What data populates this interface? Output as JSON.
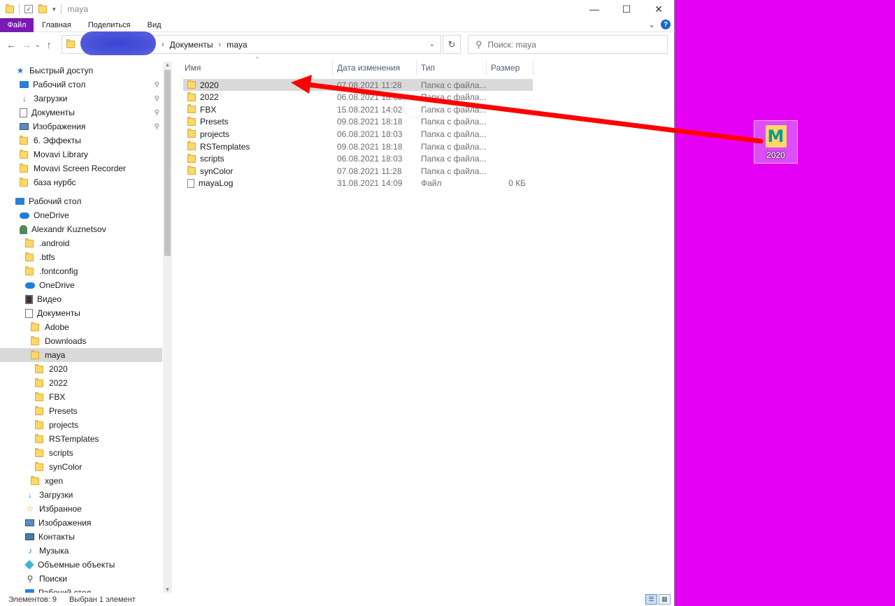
{
  "titlebar": {
    "title": "maya",
    "controls": {
      "minimize": "—",
      "maximize": "☐",
      "close": "✕"
    }
  },
  "ribbon": {
    "tabs": [
      "Файл",
      "Главная",
      "Поделиться",
      "Вид"
    ],
    "collapse": "⌄",
    "help": "?"
  },
  "nav": {
    "back": "←",
    "forward": "→",
    "recent": "⌄",
    "up": "↑",
    "breadcrumb": [
      "Документы",
      "maya"
    ],
    "sep": "›",
    "refresh": "↻",
    "dropdown": "⌄"
  },
  "search": {
    "placeholder": "Поиск: maya",
    "icon": "search-icon"
  },
  "sidebar": {
    "items": [
      {
        "label": "Быстрый доступ",
        "icon": "star-icon",
        "indent": 0
      },
      {
        "label": "Рабочий стол",
        "icon": "desktop-icon",
        "indent": 1,
        "pinned": true
      },
      {
        "label": "Загрузки",
        "icon": "download-icon",
        "indent": 1,
        "pinned": true
      },
      {
        "label": "Документы",
        "icon": "documents-icon",
        "indent": 1,
        "pinned": true
      },
      {
        "label": "Изображения",
        "icon": "pictures-icon",
        "indent": 1,
        "pinned": true
      },
      {
        "label": "6. Эффекты",
        "icon": "folder-icon",
        "indent": 1
      },
      {
        "label": "Movavi Library",
        "icon": "folder-icon",
        "indent": 1
      },
      {
        "label": "Movavi Screen Recorder",
        "icon": "folder-icon",
        "indent": 1
      },
      {
        "label": "база нурбс",
        "icon": "folder-icon",
        "indent": 1
      },
      {
        "label": "Рабочий стол",
        "icon": "desktop-icon",
        "indent": 0
      },
      {
        "label": "OneDrive",
        "icon": "onedrive-icon",
        "indent": 1
      },
      {
        "label": "Alexandr Kuznetsov",
        "icon": "user-icon",
        "indent": 1
      },
      {
        "label": ".android",
        "icon": "folder-icon",
        "indent": 2
      },
      {
        "label": ".btfs",
        "icon": "folder-icon",
        "indent": 2
      },
      {
        "label": ".fontconfig",
        "icon": "folder-icon",
        "indent": 2
      },
      {
        "label": "OneDrive",
        "icon": "onedrive-icon",
        "indent": 2
      },
      {
        "label": "Видео",
        "icon": "video-icon",
        "indent": 2
      },
      {
        "label": "Документы",
        "icon": "documents-icon",
        "indent": 2
      },
      {
        "label": "Adobe",
        "icon": "folder-icon",
        "indent": 3
      },
      {
        "label": "Downloads",
        "icon": "folder-icon",
        "indent": 3
      },
      {
        "label": "maya",
        "icon": "folder-icon",
        "indent": 3,
        "selected": true
      },
      {
        "label": "2020",
        "icon": "folder-icon",
        "indent": 4
      },
      {
        "label": "2022",
        "icon": "folder-icon",
        "indent": 4
      },
      {
        "label": "FBX",
        "icon": "folder-icon",
        "indent": 4
      },
      {
        "label": "Presets",
        "icon": "folder-icon",
        "indent": 4
      },
      {
        "label": "projects",
        "icon": "folder-icon",
        "indent": 4
      },
      {
        "label": "RSTemplates",
        "icon": "folder-icon",
        "indent": 4
      },
      {
        "label": "scripts",
        "icon": "folder-icon",
        "indent": 4
      },
      {
        "label": "synColor",
        "icon": "folder-icon",
        "indent": 4
      },
      {
        "label": "xgen",
        "icon": "folder-icon",
        "indent": 3
      },
      {
        "label": "Загрузки",
        "icon": "download-icon",
        "indent": 2
      },
      {
        "label": "Избранное",
        "icon": "favorites-icon",
        "indent": 2
      },
      {
        "label": "Изображения",
        "icon": "pictures-icon",
        "indent": 2
      },
      {
        "label": "Контакты",
        "icon": "contacts-icon",
        "indent": 2
      },
      {
        "label": "Музыка",
        "icon": "music-icon",
        "indent": 2
      },
      {
        "label": "Объемные объекты",
        "icon": "3d-objects-icon",
        "indent": 2
      },
      {
        "label": "Поиски",
        "icon": "searches-icon",
        "indent": 2
      },
      {
        "label": "Рабочий стол",
        "icon": "desktop-icon",
        "indent": 2
      }
    ]
  },
  "filelist": {
    "columns": [
      "Имя",
      "Дата изменения",
      "Тип",
      "Размер"
    ],
    "rows": [
      {
        "name": "2020",
        "date": "07.08.2021 11:28",
        "type": "Папка с файла...",
        "size": "",
        "kind": "folder",
        "selected": true
      },
      {
        "name": "2022",
        "date": "06.08.2021 18:03",
        "type": "Папка с файла...",
        "size": "",
        "kind": "folder"
      },
      {
        "name": "FBX",
        "date": "15.08.2021 14:02",
        "type": "Папка с файла...",
        "size": "",
        "kind": "folder"
      },
      {
        "name": "Presets",
        "date": "09.08.2021 18:18",
        "type": "Папка с файла...",
        "size": "",
        "kind": "folder"
      },
      {
        "name": "projects",
        "date": "06.08.2021 18:03",
        "type": "Папка с файла...",
        "size": "",
        "kind": "folder"
      },
      {
        "name": "RSTemplates",
        "date": "09.08.2021 18:18",
        "type": "Папка с файла...",
        "size": "",
        "kind": "folder"
      },
      {
        "name": "scripts",
        "date": "06.08.2021 18:03",
        "type": "Папка с файла...",
        "size": "",
        "kind": "folder"
      },
      {
        "name": "synColor",
        "date": "07.08.2021 11:28",
        "type": "Папка с файла...",
        "size": "",
        "kind": "folder"
      },
      {
        "name": "mayaLog",
        "date": "31.08.2021 14:09",
        "type": "Файл",
        "size": "0 КБ",
        "kind": "file"
      }
    ]
  },
  "statusbar": {
    "count": "Элементов: 9",
    "selection": "Выбран 1 элемент"
  },
  "desktop": {
    "drag_icon_label": "2020",
    "drag_icon_letter": "M",
    "background_color": "#e500f5"
  },
  "annotation": {
    "arrow_color": "#ff0000"
  },
  "colors": {
    "file_tab": "#7b19b5",
    "selection": "#d9d9d9"
  }
}
